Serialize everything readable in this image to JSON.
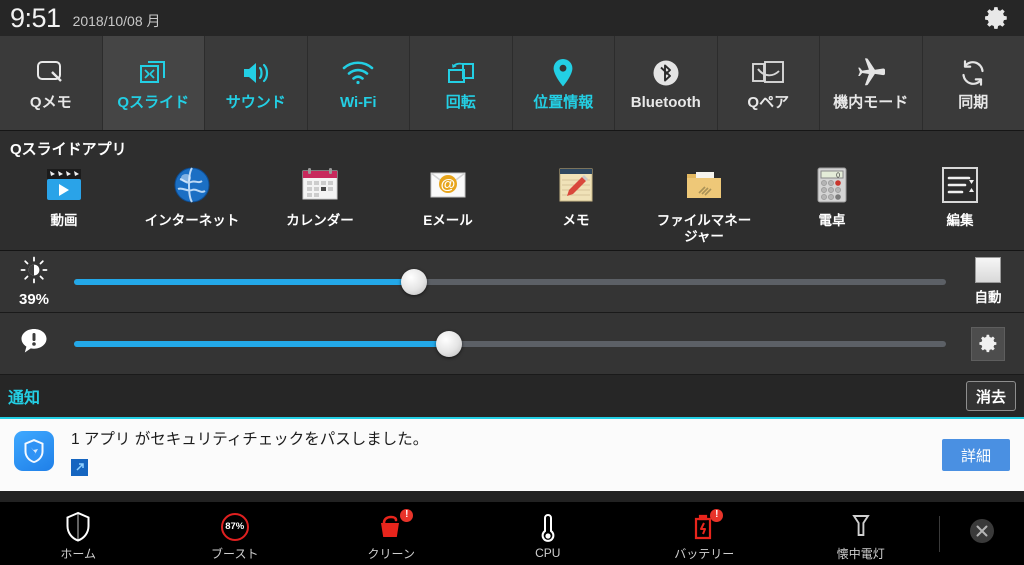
{
  "statusbar": {
    "time": "9:51",
    "date": "2018/10/08 月",
    "settings_icon": "gear-icon"
  },
  "quick_toggles": [
    {
      "label": "Qメモ",
      "icon": "qmemo-icon",
      "state": "off",
      "selected": false
    },
    {
      "label": "Qスライド",
      "icon": "qslide-icon",
      "state": "on",
      "selected": true
    },
    {
      "label": "サウンド",
      "icon": "sound-icon",
      "state": "on",
      "selected": false
    },
    {
      "label": "Wi-Fi",
      "icon": "wifi-icon",
      "state": "on",
      "selected": false
    },
    {
      "label": "回転",
      "icon": "rotation-icon",
      "state": "on",
      "selected": false
    },
    {
      "label": "位置情報",
      "icon": "location-icon",
      "state": "on",
      "selected": false
    },
    {
      "label": "Bluetooth",
      "icon": "bluetooth-icon",
      "state": "off",
      "selected": false
    },
    {
      "label": "Qペア",
      "icon": "qpair-icon",
      "state": "off",
      "selected": false
    },
    {
      "label": "機内モード",
      "icon": "airplane-icon",
      "state": "off",
      "selected": false
    },
    {
      "label": "同期",
      "icon": "sync-icon",
      "state": "off",
      "selected": false
    }
  ],
  "qslide": {
    "title": "Qスライドアプリ",
    "apps": [
      {
        "label": "動画",
        "icon": "video-icon"
      },
      {
        "label": "インターネット",
        "icon": "browser-icon"
      },
      {
        "label": "カレンダー",
        "icon": "calendar-icon"
      },
      {
        "label": "Eメール",
        "icon": "email-icon"
      },
      {
        "label": "メモ",
        "icon": "memo-icon"
      },
      {
        "label": "ファイルマネージャー",
        "icon": "file-manager-icon"
      },
      {
        "label": "電卓",
        "icon": "calculator-icon"
      },
      {
        "label": "編集",
        "icon": "edit-icon"
      }
    ]
  },
  "brightness": {
    "icon": "brightness-icon",
    "percent_label": "39%",
    "value": 39,
    "auto_label": "自動",
    "auto_checked": false
  },
  "volume": {
    "icon": "notification-volume-icon",
    "value": 43,
    "settings_icon": "gear-icon"
  },
  "notifications": {
    "header_label": "通知",
    "clear_label": "消去",
    "items": [
      {
        "icon": "shield-icon",
        "text": "1 アプリ がセキュリティチェックをパスしました。",
        "sub_icon": "shortcut-icon",
        "action_label": "詳細"
      }
    ]
  },
  "bottom_bar": {
    "items": [
      {
        "label": "ホーム",
        "icon": "shield-icon",
        "badge": ""
      },
      {
        "label": "ブースト",
        "icon": "boost-ring-icon",
        "value": "87%",
        "badge": ""
      },
      {
        "label": "クリーン",
        "icon": "clean-bucket-icon",
        "badge": "!"
      },
      {
        "label": "CPU",
        "icon": "thermometer-icon",
        "badge": ""
      },
      {
        "label": "バッテリー",
        "icon": "battery-icon",
        "badge": "!"
      },
      {
        "label": "懐中電灯",
        "icon": "flashlight-icon",
        "badge": ""
      }
    ],
    "close_icon": "close-icon"
  },
  "colors": {
    "accent_cyan": "#23cfe4",
    "slider_blue": "#23a8e8",
    "button_blue": "#4a90e2",
    "alert_red": "#e02020",
    "panel_bg": "#343434"
  }
}
